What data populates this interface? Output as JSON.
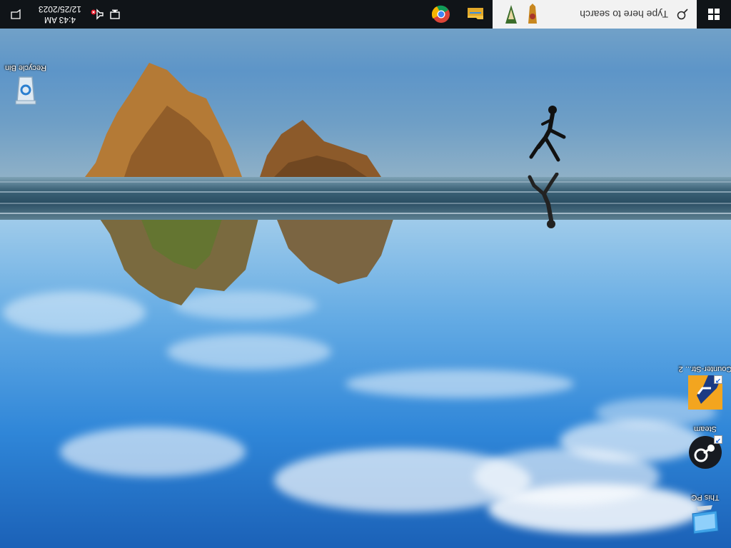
{
  "desktop": {
    "icons": [
      {
        "name": "recycle-bin",
        "label": "Recycle Bin"
      },
      {
        "name": "counter-strike-2",
        "label": "Counter-Str... 2"
      },
      {
        "name": "steam",
        "label": "Steam"
      },
      {
        "name": "this-pc",
        "label": "This PC"
      }
    ]
  },
  "taskbar": {
    "search_placeholder": "Type here to search",
    "apps": [
      {
        "name": "file-explorer",
        "icon": "folder-icon"
      },
      {
        "name": "google-chrome",
        "icon": "chrome-icon"
      }
    ],
    "tray": {
      "icons": [
        "network-icon",
        "volume-muted-icon"
      ],
      "time": "4:43 AM",
      "date": "12/25/2023"
    }
  },
  "colors": {
    "taskbar": "#101418",
    "search_bg": "#f2f2f2",
    "accent": "#0078d7"
  }
}
